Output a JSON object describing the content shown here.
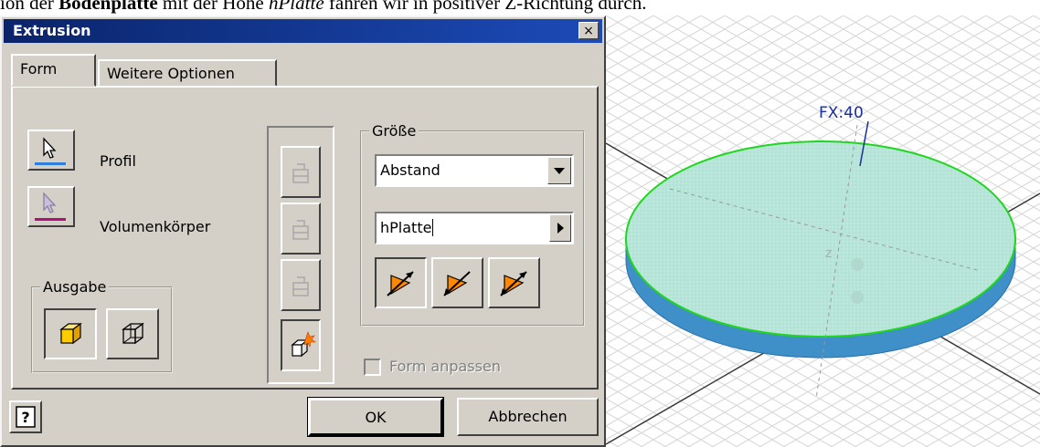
{
  "document": {
    "pre": "ion der ",
    "bold": "Bodenplatte",
    "mid": " mit der Höhe ",
    "italic": "hPlatte",
    "post": " fahren wir in positiver Z-Richtung durch."
  },
  "dialog": {
    "title": "Extrusion",
    "close_symbol": "×",
    "tabs": [
      "Form",
      "Weitere Optionen"
    ],
    "profile_label": "Profil",
    "solid_label": "Volumenkörper",
    "output_group": "Ausgabe",
    "size_group": "Größe",
    "extent_type": "Abstand",
    "distance_value": "hPlatte",
    "match_shape_label": "Form anpassen",
    "help_symbol": "?",
    "ok_label": "OK",
    "cancel_label": "Abbrechen"
  },
  "viewport": {
    "feature_label": "FX:40",
    "accent_green": "#21d621",
    "face_color": "#bde8dd",
    "side_color": "#3f8fc8"
  }
}
